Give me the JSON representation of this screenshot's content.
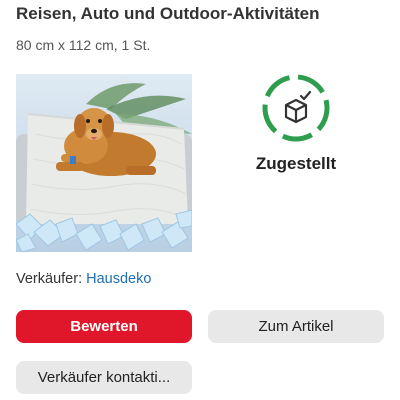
{
  "product": {
    "title": "Reisen, Auto und Outdoor-Aktivitäten",
    "subtitle": "80 cm x 112 cm, 1 St.",
    "image": "dog-on-cooling-blanket-photo"
  },
  "status": {
    "icon": "package-delivered-icon",
    "label": "Zugestellt",
    "color": "#2e9e4e"
  },
  "seller": {
    "prefix": "Verkäufer: ",
    "name": "Hausdeko",
    "link_color": "#1f6fb5"
  },
  "actions": {
    "rate_label": "Bewerten",
    "article_label": "Zum Artikel",
    "contact_label": "Verkäufer kontakti..."
  },
  "colors": {
    "accent": "#e0162b",
    "secondary_button": "#e8e8e8"
  }
}
